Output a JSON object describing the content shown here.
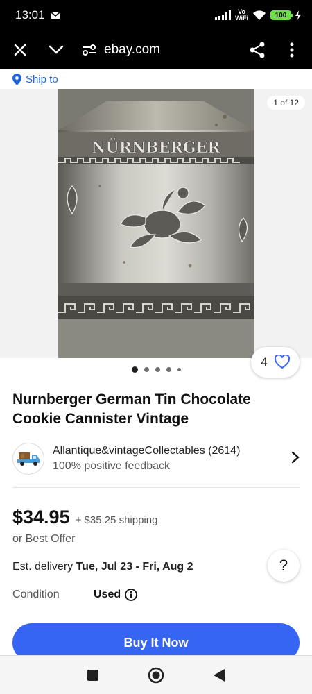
{
  "status_bar": {
    "time": "13:01",
    "network_label_top": "Vo",
    "network_label_bottom": "WiFi",
    "battery": "100"
  },
  "browser": {
    "url": "ebay.com"
  },
  "ship_to": {
    "label": "Ship to"
  },
  "gallery": {
    "counter": "1 of 12",
    "tin_brand_text": "NÜRNBERGER",
    "watch_count": "4",
    "current_image": 1,
    "dot_count": 5
  },
  "listing": {
    "title": "Nurnberger German Tin Chocolate Cookie Cannister Vintage",
    "seller_name": "Allantique&vintageCollectables (2614)",
    "seller_feedback": "100% positive feedback",
    "price": "$34.95",
    "shipping": "+ $35.25 shipping",
    "best_offer": "or Best Offer",
    "delivery_label": "Est. delivery",
    "delivery_dates": "Tue, Jul 23 - Fri, Aug 2",
    "help_label": "?",
    "condition_label": "Condition",
    "condition_value": "Used",
    "buy_button": "Buy It Now"
  },
  "colors": {
    "accent": "#3665f3",
    "link": "#1e63d8"
  }
}
